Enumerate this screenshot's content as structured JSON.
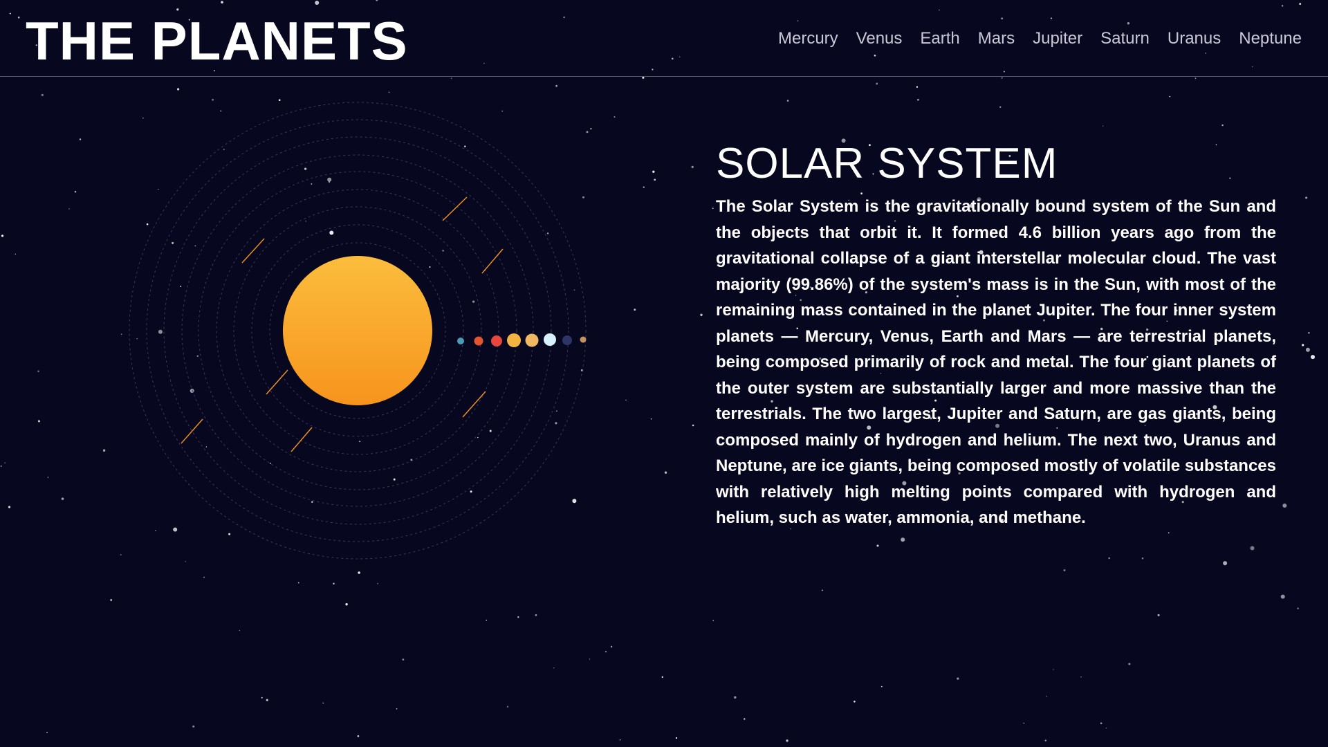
{
  "site": {
    "title": "THE PLANETS"
  },
  "nav": {
    "items": [
      {
        "label": "Mercury"
      },
      {
        "label": "Venus"
      },
      {
        "label": "Earth"
      },
      {
        "label": "Mars"
      },
      {
        "label": "Jupiter"
      },
      {
        "label": "Saturn"
      },
      {
        "label": "Uranus"
      },
      {
        "label": "Neptune"
      }
    ]
  },
  "main": {
    "heading": "SOLAR SYSTEM",
    "description": "The Solar System is the gravitationally bound system of the Sun and the objects that orbit it. It formed 4.6 billion years ago from the gravitational collapse of a giant interstellar molecular cloud. The vast majority (99.86%) of the system's mass is in the Sun, with most of the remaining mass contained in the planet Jupiter. The four inner system planets — Mercury, Venus, Earth and Mars — are terrestrial planets, being composed primarily of rock and metal. The four giant planets of the outer system are substantially larger and more massive than the terrestrials. The two largest, Jupiter and Saturn, are gas giants, being composed mainly of hydrogen and helium. The next two, Uranus and Neptune, are ice giants, being composed mostly of volatile substances with relatively high melting points compared with hydrogen and helium, such as water, ammonia, and methane."
  },
  "orrery": {
    "sun_icon": "sun-icon",
    "sun_colors": [
      "#fbbd3d",
      "#f7941d"
    ],
    "planets": [
      {
        "name": "mercury",
        "color": "#4a9cb4"
      },
      {
        "name": "venus",
        "color": "#e2562f"
      },
      {
        "name": "earth",
        "color": "#e8473e"
      },
      {
        "name": "mars",
        "color": "#f3b340"
      },
      {
        "name": "jupiter",
        "color": "#f0b862"
      },
      {
        "name": "saturn",
        "color": "#d8f0fb"
      },
      {
        "name": "uranus",
        "color": "#2c3566"
      },
      {
        "name": "neptune",
        "color": "#c5915c"
      }
    ]
  },
  "colors": {
    "background": "#070720",
    "nav_text": "#c9c9d6",
    "comet": "#f7941d"
  }
}
